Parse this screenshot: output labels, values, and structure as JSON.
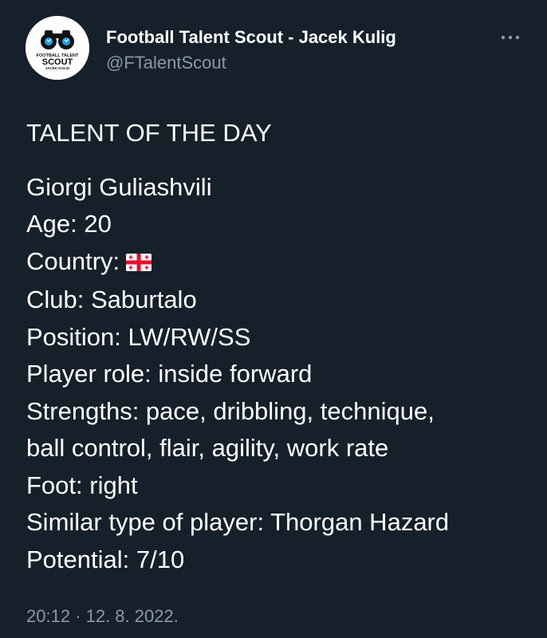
{
  "author": {
    "display_name": "Football Talent Scout - Jacek Kulig",
    "handle": "@FTalentScout",
    "avatar": {
      "logo_line1": "FOOTBALL TALENT",
      "logo_line2": "SCOUT",
      "logo_line3": "JACEK KULIG",
      "icon": "binoculars-icon"
    }
  },
  "more_icon": "more-options-icon",
  "tweet": {
    "heading": "TALENT OF THE DAY",
    "name": "Giorgi Guliashvili",
    "age": "Age: 20",
    "country_label": "Country:",
    "country_flag": "georgia-flag-icon",
    "club": "Club: Saburtalo",
    "position": "Position: LW/RW/SS",
    "role": "Player role: inside forward",
    "strengths_1": "Strengths: pace, dribbling, technique,",
    "strengths_2": "ball control, flair, agility, work rate",
    "foot": "Foot: right",
    "similar": "Similar type of player: Thorgan Hazard",
    "potential": "Potential: 7/10"
  },
  "timestamp": "20:12 · 12. 8. 2022.",
  "colors": {
    "background": "#15202b",
    "primary_text": "#ffffff",
    "secondary_text": "#8b98a5",
    "flag_red": "#e8112d"
  }
}
